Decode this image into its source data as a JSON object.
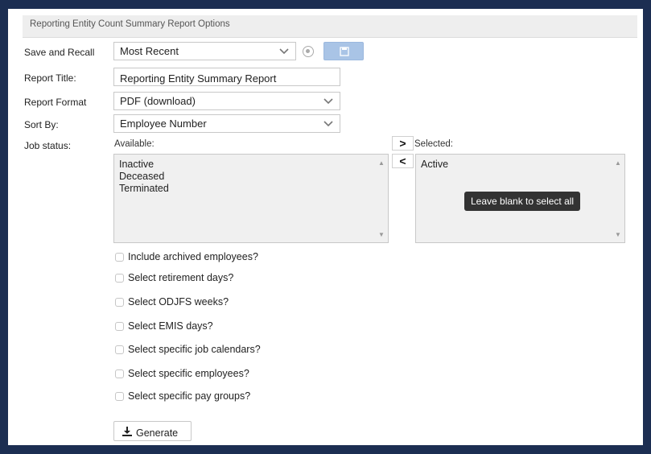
{
  "header": {
    "title": "Reporting Entity Count Summary Report Options"
  },
  "save_recall": {
    "label": "Save and Recall",
    "value": "Most Recent"
  },
  "report_title": {
    "label": "Report Title:",
    "value": "Reporting Entity Summary Report"
  },
  "report_format": {
    "label": "Report Format",
    "value": "PDF (download)"
  },
  "sort_by": {
    "label": "Sort By:",
    "value": "Employee Number"
  },
  "job_status": {
    "label": "Job status:",
    "available_label": "Available:",
    "selected_label": "Selected:",
    "available": [
      "Inactive",
      "Deceased",
      "Terminated"
    ],
    "selected": [
      "Active"
    ],
    "add_glyph": ">",
    "remove_glyph": "<",
    "tooltip": "Leave blank to select all"
  },
  "options": [
    "Include archived employees?",
    "Select retirement days?",
    "Select ODJFS weeks?",
    "Select EMIS days?",
    "Select specific job calendars?",
    "Select specific employees?",
    "Select specific pay groups?"
  ],
  "generate": {
    "label": "Generate",
    "icon": "download-icon"
  },
  "colors": {
    "frame": "#1c2e52",
    "save_button": "#a9c4e6",
    "tooltip": "#333333"
  }
}
